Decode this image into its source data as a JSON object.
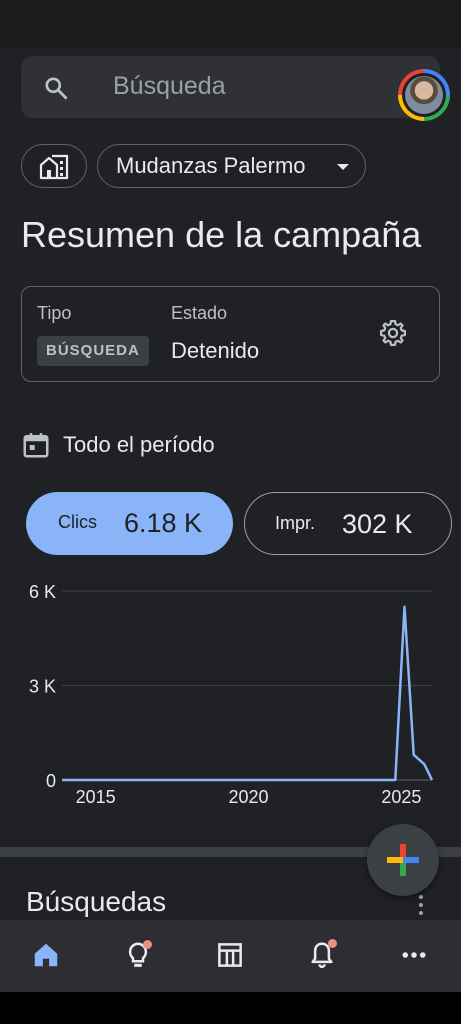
{
  "search": {
    "placeholder": "Búsqueda"
  },
  "account": {
    "name": "Mudanzas Palermo"
  },
  "page": {
    "title": "Resumen de la campaña"
  },
  "campaign": {
    "type_label": "Tipo",
    "type_value": "BÚSQUEDA",
    "status_label": "Estado",
    "status_value": "Detenido"
  },
  "period": {
    "label": "Todo el período"
  },
  "metrics": [
    {
      "label": "Clics",
      "value": "6.18 K",
      "active": true
    },
    {
      "label": "Impr.",
      "value": "302 K",
      "active": false
    }
  ],
  "chart_data": {
    "type": "line",
    "y_ticks": [
      "6 K",
      "3 K",
      "0"
    ],
    "x_ticks": [
      "2015",
      "2020",
      "2025"
    ],
    "ylim": [
      0,
      6000
    ],
    "xlim": [
      2013.9,
      2026.0
    ],
    "grid": true,
    "series": [
      {
        "color": "#8ab4f8",
        "x": [
          2013.9,
          2024.8,
          2025.1,
          2025.4,
          2025.75,
          2026.0
        ],
        "y": [
          0,
          0,
          5500,
          800,
          500,
          0
        ]
      }
    ]
  },
  "section": {
    "title": "Búsquedas"
  },
  "nav": {
    "items": [
      "home-icon",
      "lightbulb-icon",
      "table-icon",
      "notifications-icon",
      "more-icon"
    ],
    "accent": "#8ab4f8",
    "badge_color": "#f28b82"
  }
}
